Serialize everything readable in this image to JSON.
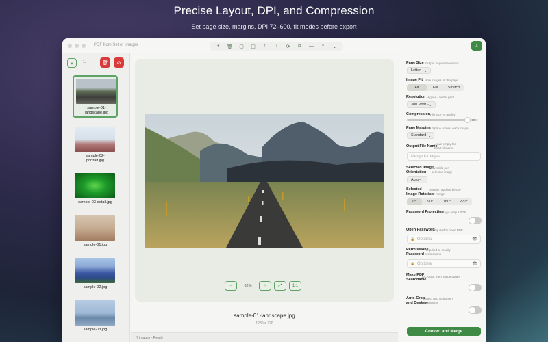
{
  "hero": {
    "title": "Precise Layout, DPI, and Compression",
    "subtitle": "Set page size, margins, DPI 72–600, fit modes before export"
  },
  "window": {
    "title": "PDF from Set of Images"
  },
  "toolbar": {
    "icons": [
      "plus-icon",
      "trash-icon",
      "page-icon",
      "sidebar-icon",
      "arrow-up-icon",
      "arrow-down-icon",
      "rotate-icon",
      "crop-icon",
      "minus-icon",
      "chevron-up-icon",
      "chevron-down-icon"
    ],
    "glyphs": [
      "+",
      "🗑",
      "▢",
      "◫",
      "↑",
      "↓",
      "⟳",
      "⧉",
      "—",
      "⌃",
      "⌄"
    ],
    "export_glyph": "⇩"
  },
  "sidebar": {
    "count_label": "1..",
    "items": [
      {
        "label": "sample-01-\nlandscape.jpg",
        "selected": true,
        "color": "#6f7d86"
      },
      {
        "label": "sample-02-\nportrait.jpg",
        "selected": false,
        "color": "#c48c8f"
      },
      {
        "label": "sample-03-detail.jpg",
        "selected": false,
        "color": "#1e8a2e"
      },
      {
        "label": "sample-01.jpg",
        "selected": false,
        "color": "#b99a82"
      },
      {
        "label": "sample-02.jpg",
        "selected": false,
        "color": "#4e6ea8"
      },
      {
        "label": "sample-03.jpg",
        "selected": false,
        "color": "#8ba6c2"
      }
    ]
  },
  "canvas": {
    "zoom_level": "62%",
    "zoom_out": "−",
    "zoom_in": "+",
    "fit_label": "⤢",
    "actual_size": "1:1",
    "file_name": "sample-01-landscape.jpg",
    "file_dims": "1280 × 720"
  },
  "status": {
    "text": "7 images · Ready"
  },
  "settings": {
    "page_size": {
      "label": "Page Size",
      "hint": "Output page dimensions",
      "value": "Letter"
    },
    "image_fit": {
      "label": "Image Fit",
      "hint": "How images fill the page",
      "options": [
        "Fit",
        "Fill",
        "Stretch"
      ],
      "selected": "Fit"
    },
    "resolution": {
      "label": "Resolution",
      "hint": "Higher = better print",
      "value": "300 Print"
    },
    "compression": {
      "label": "Compression",
      "hint": "File size vs quality",
      "value": "85",
      "fraction": 0.85
    },
    "page_margins": {
      "label": "Page Margins",
      "hint": "Space around each image",
      "value": "Standard"
    },
    "output_name": {
      "label": "Output File Name",
      "hint": "Leave empty for\nsmart filename",
      "placeholder": "Merged-Images"
    },
    "orientation": {
      "label": "Selected Image\nOrientation",
      "hint": "Override per\nselected image",
      "value": "Auto"
    },
    "rotation": {
      "label": "Selected\nImage Rotation",
      "hint": "Rotation applied before\nPDF merge",
      "options": [
        "0°",
        "90°",
        "180°",
        "270°"
      ],
      "selected": "0°"
    },
    "password_protection": {
      "label": "Password Protection",
      "hint": "Encrypt output PDF",
      "enabled": false
    },
    "open_password": {
      "label": "Open Password",
      "hint": "Required to open PDF",
      "placeholder": "Optional"
    },
    "permissions_password": {
      "label": "Permissions\nPassword",
      "hint": "Required to modify\npermissions",
      "placeholder": "Optional"
    },
    "ocr": {
      "label": "Make PDF\nSearchable",
      "hint": "OCR text from image pages",
      "enabled": false
    },
    "autocrop": {
      "label": "Auto-Crop\nand Deskew",
      "hint": "Detect and straighten\ndocuments",
      "enabled": false
    },
    "convert_label": "Convert and Merge",
    "dropdown_caret": "⌃⌄",
    "lock_glyph": "🔒",
    "eye_glyph": "👁"
  },
  "colors": {
    "accent": "#3f8a44",
    "danger": "#d93a3a"
  }
}
